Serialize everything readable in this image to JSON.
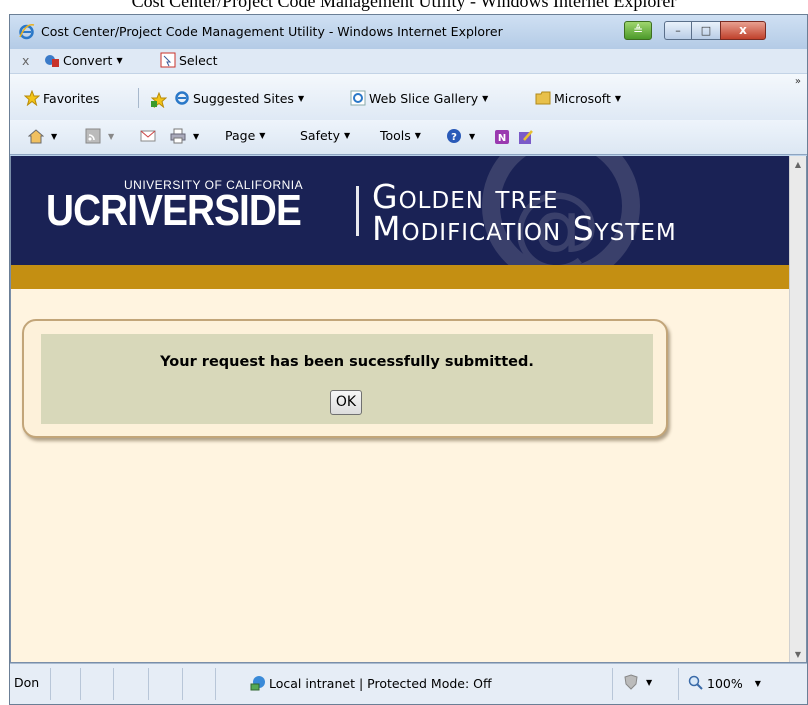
{
  "caption": "Cost Center/Project Code Management Utility - Windows Internet Explorer",
  "window": {
    "title": "Cost Center/Project Code Management Utility - Windows Internet Explorer",
    "controls": {
      "minimize": "–",
      "maximize": "□",
      "close": "x"
    }
  },
  "toolbar_convert": {
    "close_glyph": "x",
    "convert_label": "Convert",
    "select_label": "Select"
  },
  "favorites_bar": {
    "favorites_label": "Favorites",
    "items": [
      "Suggested Sites",
      "Web Slice Gallery",
      "Microsoft"
    ]
  },
  "command_bar": {
    "page_label": "Page",
    "safety_label": "Safety",
    "tools_label": "Tools"
  },
  "banner": {
    "university": "UNIVERSITY OF CALIFORNIA",
    "campus": "UCRIVERSIDE",
    "title_line1": "Golden tree",
    "title_line2": "Modification System"
  },
  "dialog": {
    "message": "Your request has been sucessfully submitted.",
    "ok_label": "OK"
  },
  "status": {
    "text": "Don",
    "zone": "Local intranet | Protected Mode: Off",
    "zoom": "100%"
  }
}
